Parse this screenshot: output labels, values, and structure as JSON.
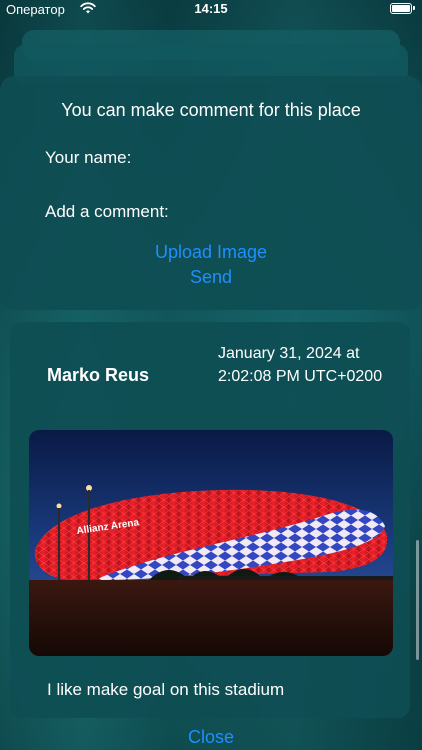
{
  "status_bar": {
    "carrier": "Оператор",
    "time": "14:15"
  },
  "comment_form": {
    "title": "You can make comment for this place",
    "name_label": "Your name:",
    "comment_label": "Add a comment:",
    "upload_label": "Upload Image",
    "send_label": "Send"
  },
  "review": {
    "author": "Marko Reus",
    "date": "January 31, 2024 at 2:02:08 PM UTC+0200",
    "photo_text": "Allianz Arena",
    "text": "I like make goal on this stadium"
  },
  "footer": {
    "close_label": "Close"
  },
  "colors": {
    "accent": "#1f8fff",
    "card_bg": "#0e4e54"
  }
}
